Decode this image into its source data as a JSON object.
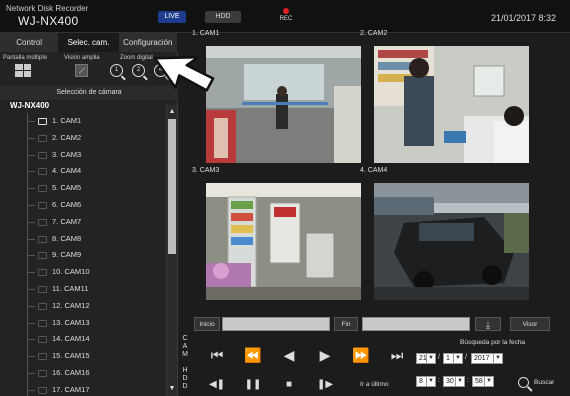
{
  "header": {
    "product": "Network Disk Recorder",
    "model": "WJ-NX400",
    "live_label": "LIVE",
    "hdd_label": "HDD",
    "rec_label": "REC",
    "datetime": "21/01/2017  8:32"
  },
  "tabs": [
    {
      "label": "Control",
      "active": false
    },
    {
      "label": "Selec. cam.",
      "active": true
    },
    {
      "label": "Configuración",
      "active": false
    }
  ],
  "tools": {
    "multi_label": "Pantalla múltiple",
    "wide_label": "Visión amplia",
    "zoom_label": "Zoom digital",
    "zoom_levels": [
      "1",
      "2",
      "4"
    ]
  },
  "camera_selection": {
    "heading": "Selección de cámara",
    "root": "WJ-NX400",
    "items": [
      "1. CAM1",
      "2. CAM2",
      "3. CAM3",
      "4. CAM4",
      "5. CAM5",
      "6. CAM6",
      "7. CAM7",
      "8. CAM8",
      "9. CAM9",
      "10. CAM10",
      "11. CAM11",
      "12. CAM12",
      "13. CAM13",
      "14. CAM14",
      "15. CAM15",
      "16. CAM16",
      "17. CAM17"
    ]
  },
  "feeds": [
    {
      "label": "1. CAM1"
    },
    {
      "label": "2. CAM2"
    },
    {
      "label": "3. CAM3"
    },
    {
      "label": "4. CAM4"
    }
  ],
  "search": {
    "inicio_label": "Inicio",
    "fin_label": "Fin",
    "visor_label": "Visor",
    "date_search_label": "Búsqueda por la fecha",
    "cam_label": "C A M",
    "hdd_label": "H D D",
    "goto_last_label": "Ir a último",
    "search_label": "Buscar",
    "day": "21",
    "month": "1",
    "year": "2017",
    "hour": "8",
    "minute": "30",
    "second": "58"
  },
  "colors": {
    "accent_live": "#1e3d8f",
    "rec_dot": "#e02020"
  }
}
